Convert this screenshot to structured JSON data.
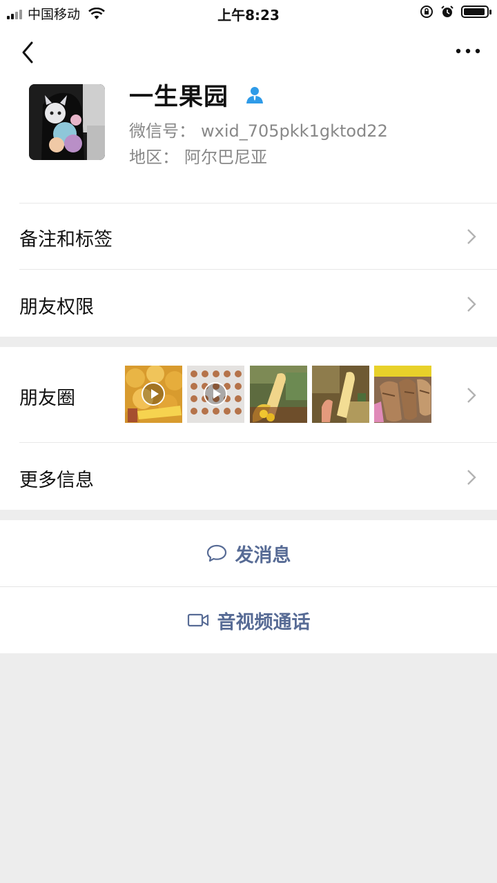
{
  "status_bar": {
    "carrier": "中国移动",
    "time": "上午8:23",
    "battery_level": 0.95
  },
  "nav": {
    "back_icon": "chevron-left-icon",
    "more_icon": "more-dots-icon"
  },
  "profile": {
    "name": "一生果园",
    "wechat_id_label": "微信号：",
    "wechat_id": "wxid_705pkk1gktod22",
    "region_label": "地区：",
    "region": "阿尔巴尼亚",
    "badge_icon": "contact-person-icon"
  },
  "menu": {
    "remarks_tags": "备注和标签",
    "friend_permissions": "朋友权限",
    "moments": "朋友圈",
    "more_info": "更多信息"
  },
  "moments_thumbs": [
    {
      "kind": "video",
      "subject": "mangoes"
    },
    {
      "kind": "video",
      "subject": "egg-crates"
    },
    {
      "kind": "image",
      "subject": "fruit-pile"
    },
    {
      "kind": "image",
      "subject": "fruit-pile"
    },
    {
      "kind": "image",
      "subject": "cassava"
    }
  ],
  "actions": {
    "send_message": "发消息",
    "video_call": "音视频通话"
  },
  "colors": {
    "link_blue": "#576b95",
    "background_gray": "#ededed",
    "badge_blue": "#2f9be8"
  }
}
